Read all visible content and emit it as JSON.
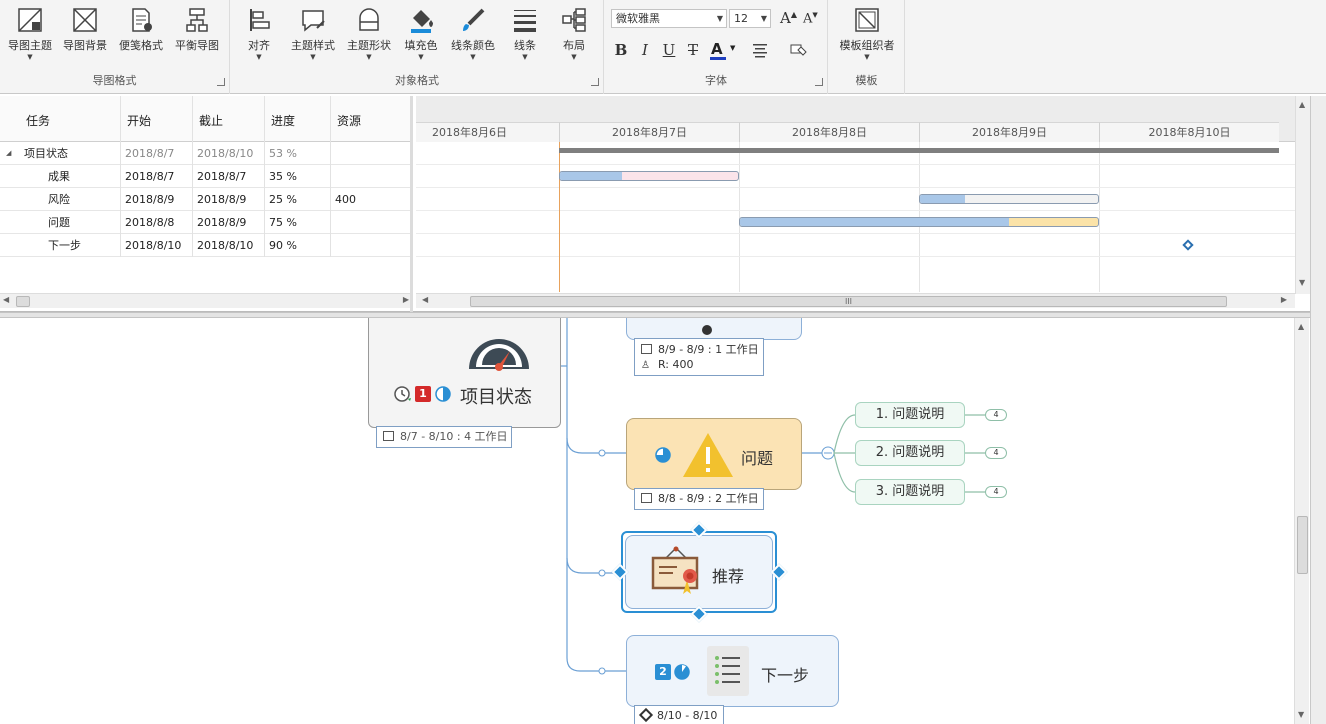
{
  "ribbon": {
    "groups": {
      "map_format": "导图格式",
      "object_format": "对象格式",
      "font": "字体",
      "template": "模板"
    },
    "buttons": {
      "map_theme": "导图主题",
      "map_background": "导图背景",
      "convenient_format": "便笺格式",
      "balance_map": "平衡导图",
      "align": "对齐",
      "topic_style": "主题样式",
      "topic_shape": "主题形状",
      "fill_color": "填充色",
      "line_color": "线条颜色",
      "lines": "线条",
      "layout": "布局",
      "template_organizer": "模板组织者"
    },
    "font_name": "微软雅黑",
    "font_size": "12",
    "format": {
      "bold": "B",
      "italic": "I",
      "underline": "U",
      "strike": "T",
      "font_color_letter": "A",
      "grow": "A",
      "shrink": "A"
    },
    "colors": {
      "font_color_bar": "#1f3fbf"
    }
  },
  "gantt": {
    "columns": {
      "task": "任务",
      "start": "开始",
      "end": "截止",
      "progress": "进度",
      "resource": "资源"
    },
    "rows": [
      {
        "task": "项目状态",
        "start": "2018/8/7",
        "end": "2018/8/10",
        "progress": "53 %",
        "resource": "",
        "progress_value": 0.53
      },
      {
        "task": "成果",
        "start": "2018/8/7",
        "end": "2018/8/7",
        "progress": "35 %",
        "resource": "",
        "progress_value": 0.35
      },
      {
        "task": "风险",
        "start": "2018/8/9",
        "end": "2018/8/9",
        "progress": "25 %",
        "resource": "400",
        "progress_value": 0.25
      },
      {
        "task": "问题",
        "start": "2018/8/8",
        "end": "2018/8/9",
        "progress": "75 %",
        "resource": "",
        "progress_value": 0.75
      },
      {
        "task": "下一步",
        "start": "2018/8/10",
        "end": "2018/8/10",
        "progress": "90 %",
        "resource": "",
        "progress_value": 0.9
      }
    ],
    "dates": [
      "2018年8月6日",
      "2018年8月7日",
      "2018年8月8日",
      "2018年8月9日",
      "2018年8月10日"
    ],
    "scroll_grip": "III",
    "colors": {
      "progress_fill": "#a9c7e8",
      "remain_pink": "#fbe4ea",
      "remain_grey": "#f2f2f2",
      "remain_yellow": "#fbe3a8",
      "summary": "#7f7f7f",
      "today_line": "#e8a25c"
    }
  },
  "mindmap": {
    "central": {
      "title": "项目状态",
      "badge_priority": "1",
      "dates": "8/7 - 8/10 : 4 工作日"
    },
    "risk_info": {
      "dates": "8/9 - 8/9 : 1 工作日",
      "resource": "R: 400"
    },
    "issue": {
      "title": "问题",
      "dates": "8/8 - 8/9 : 2 工作日",
      "subtopics": [
        "1. 问题说明",
        "2. 问题说明",
        "3. 问题说明"
      ],
      "sub_badge": "4"
    },
    "recommend": {
      "title": "推荐"
    },
    "next_step": {
      "title": "下一步",
      "badge_priority": "2",
      "dates": "8/10 - 8/10"
    },
    "colors": {
      "issue_fill": "#fbe3b4",
      "topic_fill": "#eef4fb",
      "connector": "#6a9fd4",
      "warning": "#f2c12e",
      "priority_red": "#d42a2a",
      "priority_blue": "#2a8fd4"
    }
  }
}
